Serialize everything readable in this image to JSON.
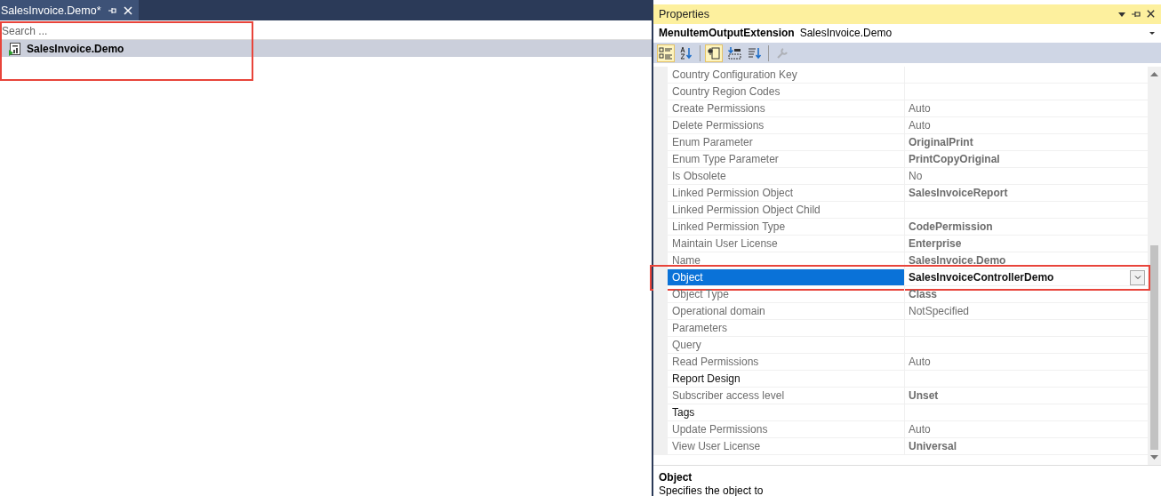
{
  "document_tab": {
    "title": "SalesInvoice.Demo*",
    "selected": true
  },
  "tree": {
    "search": {
      "placeholder": "Search ..."
    },
    "items": [
      {
        "label": "SalesInvoice.Demo",
        "selected": true
      }
    ]
  },
  "properties": {
    "title": "Properties",
    "object_type": "MenuItemOutputExtension",
    "object_name": "SalesInvoice.Demo",
    "toolbar": [
      {
        "kind": "categorized",
        "selected": true
      },
      {
        "kind": "alphabetical",
        "selected": false
      },
      {
        "kind": "separator"
      },
      {
        "kind": "properties",
        "selected": true
      },
      {
        "kind": "events",
        "selected": false
      },
      {
        "kind": "sort",
        "selected": false
      },
      {
        "kind": "separator"
      },
      {
        "kind": "wrench",
        "selected": false,
        "disabled": true
      }
    ],
    "rows": [
      {
        "name": "Country Configuration Key",
        "value": "",
        "editable": false,
        "selected": false
      },
      {
        "name": "Country Region Codes",
        "value": "",
        "editable": false,
        "selected": false
      },
      {
        "name": "Create Permissions",
        "value": "Auto",
        "modified": false,
        "editable": false,
        "selected": false
      },
      {
        "name": "Delete Permissions",
        "value": "Auto",
        "modified": false,
        "editable": false,
        "selected": false
      },
      {
        "name": "Enum Parameter",
        "value": "OriginalPrint",
        "modified": true,
        "editable": false,
        "selected": false
      },
      {
        "name": "Enum Type Parameter",
        "value": "PrintCopyOriginal",
        "modified": true,
        "editable": false,
        "selected": false
      },
      {
        "name": "Is Obsolete",
        "value": "No",
        "modified": false,
        "editable": false,
        "selected": false
      },
      {
        "name": "Linked Permission Object",
        "value": "SalesInvoiceReport",
        "modified": true,
        "editable": false,
        "selected": false
      },
      {
        "name": "Linked Permission Object Child",
        "value": "",
        "editable": false,
        "selected": false
      },
      {
        "name": "Linked Permission Type",
        "value": "CodePermission",
        "modified": true,
        "editable": false,
        "selected": false
      },
      {
        "name": "Maintain User License",
        "value": "Enterprise",
        "modified": true,
        "editable": false,
        "selected": false
      },
      {
        "name": "Name",
        "value": "SalesInvoice.Demo",
        "modified": true,
        "editable": false,
        "selected": false
      },
      {
        "name": "Object",
        "value": "SalesInvoiceControllerDemo",
        "modified": true,
        "editable": true,
        "selected": true
      },
      {
        "name": "Object Type",
        "value": "Class",
        "modified": true,
        "editable": false,
        "selected": false
      },
      {
        "name": "Operational domain",
        "value": "NotSpecified",
        "modified": false,
        "editable": false,
        "selected": false
      },
      {
        "name": "Parameters",
        "value": "",
        "editable": false,
        "selected": false
      },
      {
        "name": "Query",
        "value": "",
        "editable": false,
        "selected": false
      },
      {
        "name": "Read Permissions",
        "value": "Auto",
        "modified": false,
        "editable": false,
        "selected": false
      },
      {
        "name": "Report Design",
        "value": "",
        "editable": true,
        "selected": false
      },
      {
        "name": "Subscriber access level",
        "value": "Unset",
        "modified": true,
        "editable": false,
        "selected": false
      },
      {
        "name": "Tags",
        "value": "",
        "editable": true,
        "selected": false
      },
      {
        "name": "Update Permissions",
        "value": "Auto",
        "modified": false,
        "editable": false,
        "selected": false
      },
      {
        "name": "View User License",
        "value": "Universal",
        "modified": true,
        "editable": false,
        "selected": false
      }
    ],
    "description": {
      "title": "Object",
      "text": "Specifies the object to"
    }
  }
}
